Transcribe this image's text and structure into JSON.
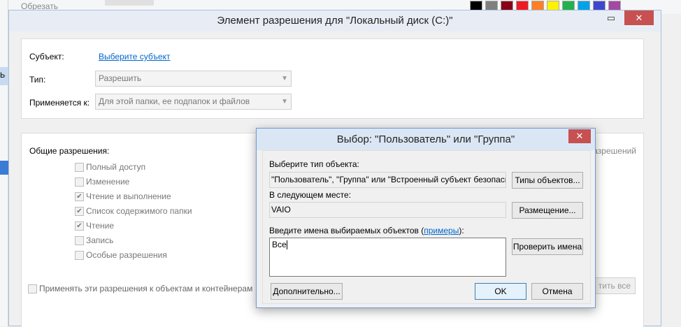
{
  "background": {
    "toolbar_item": "Обрезать",
    "side_fragments": [
      "Ь",
      "И",
      "Н"
    ],
    "colors": [
      "#000000",
      "#7f7f7f",
      "#880015",
      "#ed1c24",
      "#ff7f27",
      "#fff200",
      "#22b14c",
      "#00a2e8",
      "#3f48cc",
      "#a349a4"
    ]
  },
  "main_dialog": {
    "title": "Элемент разрешения для \"Локальный диск (C:)\"",
    "minimize": "▭",
    "close": "✕",
    "subject_label": "Субъект:",
    "subject_link": "Выберите субъект",
    "type_label": "Тип:",
    "type_value": "Разрешить",
    "applies_label": "Применяется к:",
    "applies_value": "Для этой папки, ее подпапок и файлов",
    "general_perms_label": "Общие разрешения:",
    "special_perms_link_partial": "разрешений",
    "permissions": [
      {
        "label": "Полный доступ",
        "checked": false
      },
      {
        "label": "Изменение",
        "checked": false
      },
      {
        "label": "Чтение и выполнение",
        "checked": true
      },
      {
        "label": "Список содержимого папки",
        "checked": true
      },
      {
        "label": "Чтение",
        "checked": true
      },
      {
        "label": "Запись",
        "checked": false
      },
      {
        "label": "Особые разрешения",
        "checked": false
      }
    ],
    "apply_to_containers": "Применять эти разрешения к объектам и контейнерам",
    "clear_all_partial": "тить все"
  },
  "select_dialog": {
    "title": "Выбор: \"Пользователь\" или \"Группа\"",
    "close": "✕",
    "object_type_label": "Выберите тип объекта:",
    "object_type_value": "\"Пользователь\", \"Группа\" или \"Встроенный субъект безопасност",
    "object_types_button": "Типы объектов...",
    "location_label": "В следующем месте:",
    "location_value": "VAIO",
    "locations_button": "Размещение...",
    "names_label_prefix": "Введите имена выбираемых объектов (",
    "names_label_link": "примеры",
    "names_label_suffix": "):",
    "names_value": "Все",
    "check_names_button": "Проверить имена",
    "advanced_button": "Дополнительно...",
    "ok_button": "OK",
    "cancel_button": "Отмена"
  }
}
